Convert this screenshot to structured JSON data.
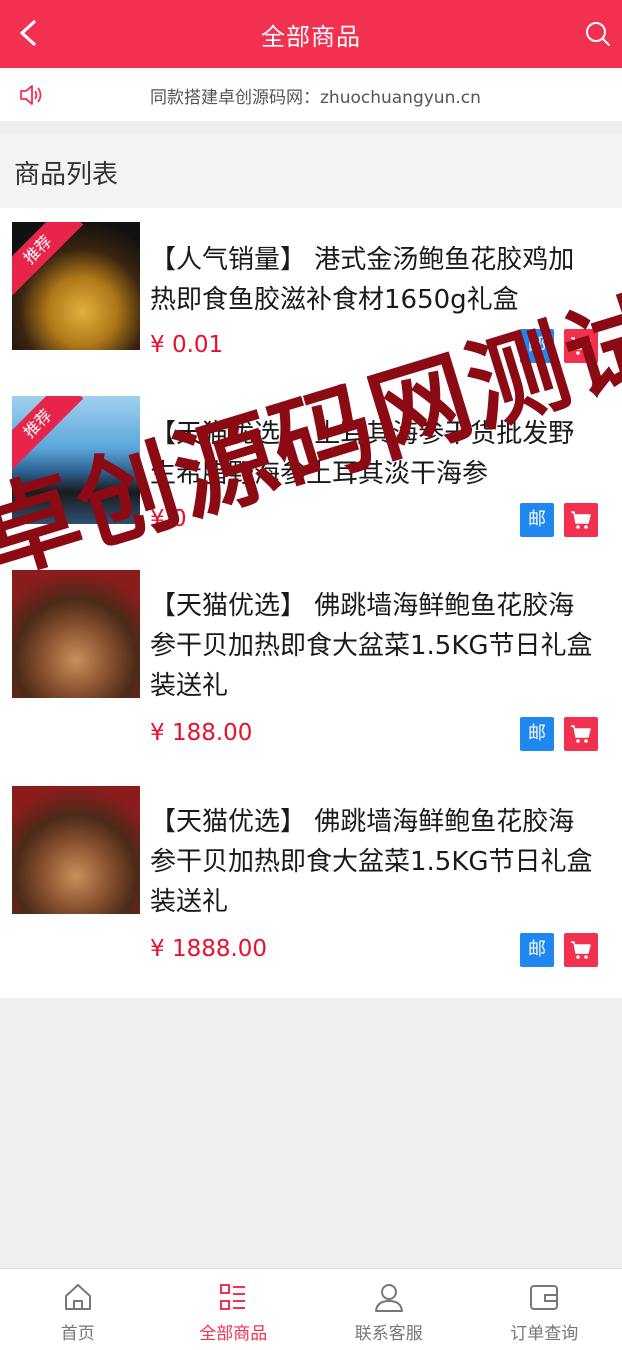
{
  "header": {
    "title": "全部商品"
  },
  "notice": {
    "text": "同款搭建卓创源码网：zhuochuangyun.cn"
  },
  "list": {
    "title": "商品列表",
    "items": [
      {
        "title": "【人气销量】 港式金汤鲍鱼花胶鸡加热即食鱼胶滋补食材1650g礼盒",
        "price": "¥ 0.01",
        "badge": "推荐",
        "mail": "邮"
      },
      {
        "title": "【天猫优选】 土耳其海参干货批发野生希腊野海参土耳其淡干海参",
        "price": "¥ 0",
        "badge": "推荐",
        "mail": "邮"
      },
      {
        "title": "【天猫优选】 佛跳墙海鲜鲍鱼花胶海参干贝加热即食大盆菜1.5KG节日礼盒装送礼",
        "price": "¥ 188.00",
        "badge": "",
        "mail": "邮"
      },
      {
        "title": "【天猫优选】 佛跳墙海鲜鲍鱼花胶海参干贝加热即食大盆菜1.5KG节日礼盒装送礼",
        "price": "¥ 1888.00",
        "badge": "",
        "mail": "邮"
      }
    ]
  },
  "watermark": "卓创源码网测试",
  "tabbar": {
    "tabs": [
      {
        "label": "首页",
        "icon": "home-icon"
      },
      {
        "label": "全部商品",
        "icon": "list-icon",
        "active": true
      },
      {
        "label": "联系客服",
        "icon": "user-icon"
      },
      {
        "label": "订单查询",
        "icon": "wallet-icon"
      }
    ]
  },
  "colors": {
    "brand": "#f2304f",
    "price": "#e8112d",
    "mail_tag": "#1e88f0"
  }
}
